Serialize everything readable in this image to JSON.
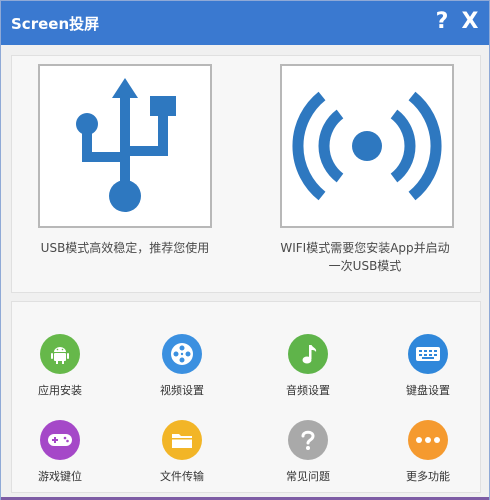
{
  "window": {
    "title": "Screen投屏",
    "help_label": "?",
    "close_label": "X"
  },
  "modes": {
    "usb": {
      "icon": "usb-icon",
      "caption": "USB模式高效稳定，推荐您使用"
    },
    "wifi": {
      "icon": "wifi-broadcast-icon",
      "caption_line1": "WIFI模式需要您安装App并启动",
      "caption_line2": "一次USB模式"
    }
  },
  "tools": [
    {
      "label": "应用安装",
      "icon": "android-icon",
      "color": "#66b84a"
    },
    {
      "label": "视频设置",
      "icon": "film-reel-icon",
      "color": "#3b90e0"
    },
    {
      "label": "音频设置",
      "icon": "music-note-icon",
      "color": "#5fb44a"
    },
    {
      "label": "键盘设置",
      "icon": "keyboard-icon",
      "color": "#2f87da"
    },
    {
      "label": "游戏键位",
      "icon": "gamepad-icon",
      "color": "#a548c8"
    },
    {
      "label": "文件传输",
      "icon": "folder-icon",
      "color": "#f2b527"
    },
    {
      "label": "常见问题",
      "icon": "question-icon",
      "color": "#a9a9a9"
    },
    {
      "label": "更多功能",
      "icon": "more-dots-icon",
      "color": "#f59a2f"
    }
  ],
  "colors": {
    "titlebar": "#3a79d0",
    "mode_icon": "#2e78c0"
  }
}
